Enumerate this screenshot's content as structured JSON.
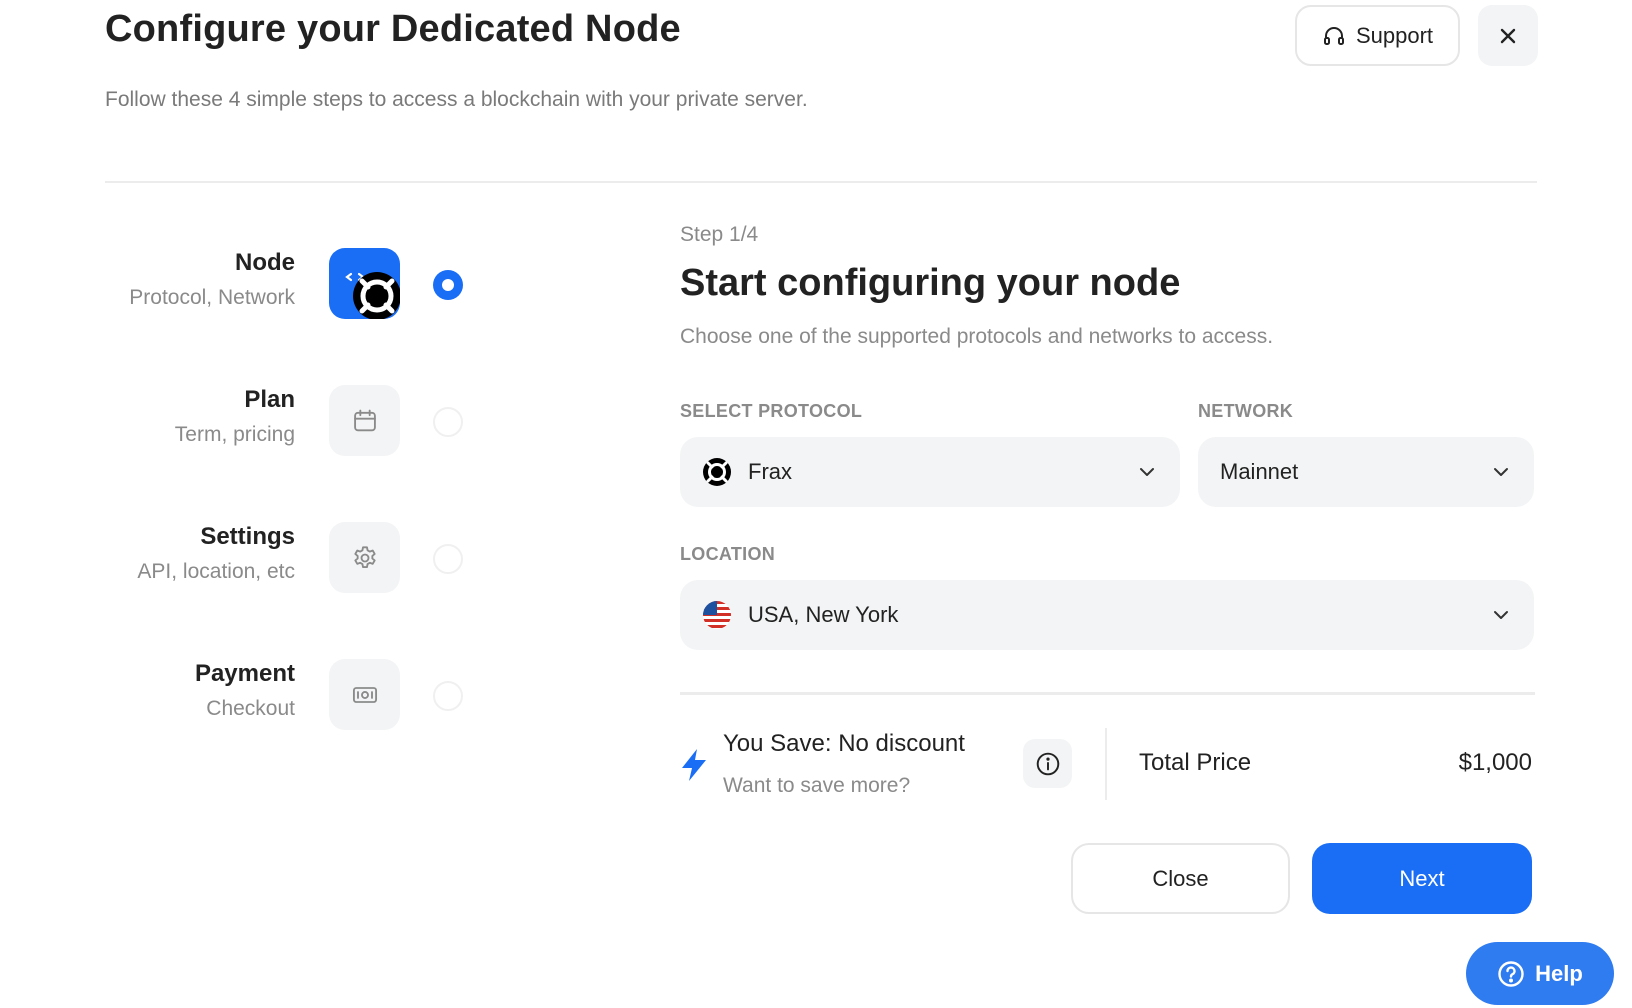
{
  "header": {
    "title": "Configure your Dedicated Node",
    "subtitle": "Follow these 4 simple steps to access a blockchain with your private server.",
    "support_label": "Support"
  },
  "stepper": [
    {
      "title": "Node",
      "subtitle": "Protocol, Network",
      "icon": "protocol-logo-icon",
      "active": true
    },
    {
      "title": "Plan",
      "subtitle": "Term, pricing",
      "icon": "calendar-icon",
      "active": false
    },
    {
      "title": "Settings",
      "subtitle": "API, location, etc",
      "icon": "gear-icon",
      "active": false
    },
    {
      "title": "Payment",
      "subtitle": "Checkout",
      "icon": "cash-icon",
      "active": false
    }
  ],
  "main": {
    "step_label": "Step 1/4",
    "title": "Start configuring your node",
    "description": "Choose one of the supported protocols and networks to access.",
    "protocol": {
      "label": "SELECT PROTOCOL",
      "value": "Frax"
    },
    "network": {
      "label": "NETWORK",
      "value": "Mainnet"
    },
    "location": {
      "label": "LOCATION",
      "value": "USA, New York"
    },
    "savings": {
      "title": "You Save: No discount",
      "subtitle": "Want to save more?"
    },
    "total": {
      "label": "Total Price",
      "value": "$1,000"
    },
    "close_label": "Close",
    "next_label": "Next"
  },
  "help_label": "Help",
  "colors": {
    "accent": "#1a6ef5",
    "muted": "#8a8a8a",
    "field_bg": "#f3f4f5"
  }
}
